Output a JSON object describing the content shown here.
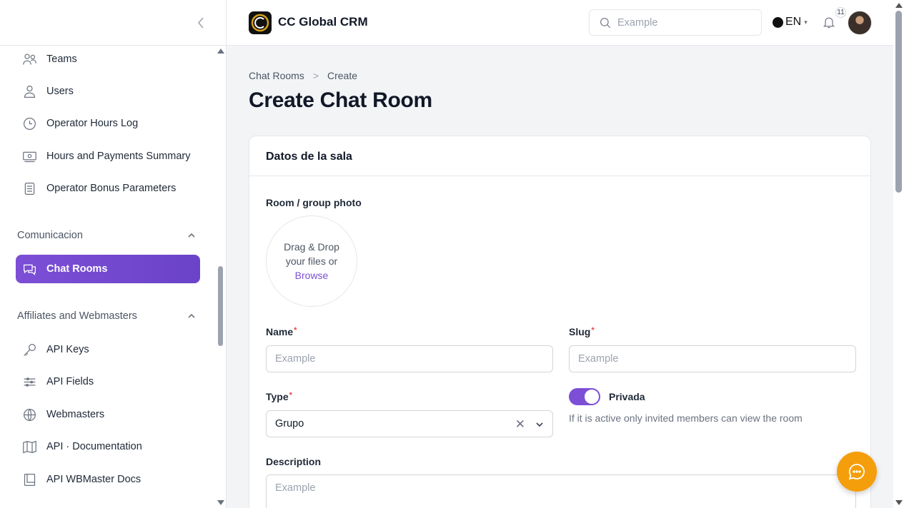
{
  "header": {
    "app_title": "CC Global CRM",
    "search_placeholder": "Example",
    "language": "EN",
    "notifications_count": "11"
  },
  "sidebar": {
    "items": [
      {
        "label": "Teams",
        "icon": "teams-icon"
      },
      {
        "label": "Users",
        "icon": "user-icon"
      },
      {
        "label": "Operator Hours Log",
        "icon": "clock-icon"
      },
      {
        "label": "Hours and Payments Summary",
        "icon": "payments-icon"
      },
      {
        "label": "Operator Bonus Parameters",
        "icon": "document-icon"
      }
    ],
    "section_comunicacion": "Comunicacion",
    "chat_rooms": "Chat Rooms",
    "section_affiliates": "Affiliates and Webmasters",
    "affiliate_items": [
      {
        "label": "API Keys",
        "icon": "key-icon"
      },
      {
        "label": "API Fields",
        "icon": "sliders-icon"
      },
      {
        "label": "Webmasters",
        "icon": "globe-icon"
      },
      {
        "label": "API · Documentation",
        "icon": "book-icon"
      },
      {
        "label": "API WBMaster Docs",
        "icon": "book-closed-icon"
      }
    ]
  },
  "breadcrumb": {
    "parent": "Chat Rooms",
    "separator": ">",
    "current": "Create"
  },
  "page_title": "Create Chat Room",
  "form": {
    "section_title": "Datos de la sala",
    "photo_label": "Room / group photo",
    "dropzone_line1": "Drag & Drop",
    "dropzone_line2": "your files or",
    "dropzone_browse": "Browse",
    "name_label": "Name",
    "name_placeholder": "Example",
    "slug_label": "Slug",
    "slug_placeholder": "Example",
    "required_mark": "*",
    "type_label": "Type",
    "type_value": "Grupo",
    "private_label": "Privada",
    "private_help": "If it is active only invited members can view the room",
    "private_enabled": true,
    "description_label": "Description",
    "description_placeholder": "Example"
  },
  "colors": {
    "accent": "#7c4fd6",
    "fab": "#f59e0b",
    "required": "#ef4444"
  }
}
